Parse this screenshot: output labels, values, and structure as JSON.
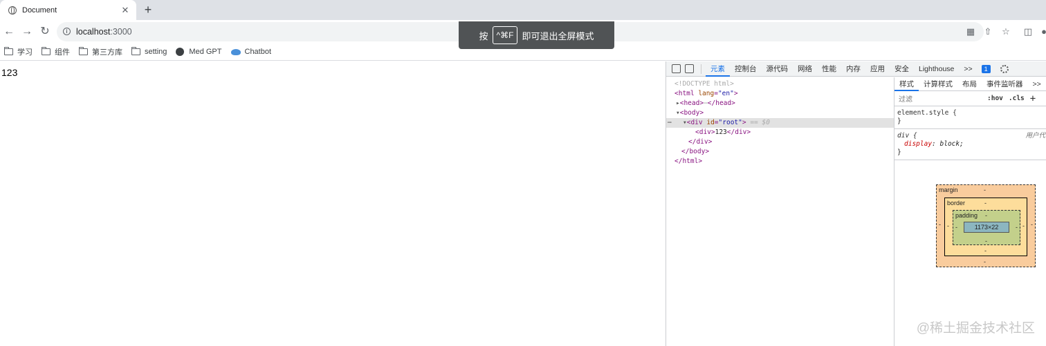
{
  "browser": {
    "tab_title": "Document",
    "close_glyph": "✕",
    "new_tab_glyph": "+",
    "url_host": "localhost",
    "url_port": ":3000",
    "info_glyph": "i"
  },
  "bookmarks": [
    {
      "label": "学习",
      "icon": "folder-icon"
    },
    {
      "label": "组件",
      "icon": "folder-icon"
    },
    {
      "label": "第三方库",
      "icon": "folder-icon"
    },
    {
      "label": "setting",
      "icon": "folder-icon"
    },
    {
      "label": "Med GPT",
      "icon": "globe-icon"
    },
    {
      "label": "Chatbot",
      "icon": "whale-icon"
    }
  ],
  "toast": {
    "prefix": "按",
    "key": "^⌘F",
    "suffix": "即可退出全屏模式"
  },
  "page": {
    "content": "123"
  },
  "devtools": {
    "tabs": [
      "元素",
      "控制台",
      "源代码",
      "网络",
      "性能",
      "内存",
      "应用",
      "安全",
      "Lighthouse"
    ],
    "more": ">>",
    "badge": "1",
    "dom": {
      "doctype": "<!DOCTYPE html>",
      "html_open": "<html ",
      "html_attr": "lang",
      "html_val": "\"en\"",
      "head": "<head>",
      "head_close": "</head>",
      "body": "<body>",
      "div_open": "<div ",
      "div_attr": "id",
      "div_val": "\"root\"",
      "div_sel_marker": "== $0",
      "inner_div_open": "<div>",
      "inner_text": "123",
      "inner_div_close": "</div>",
      "div_close": "</div>",
      "body_close": "</body>",
      "html_close": "</html>"
    },
    "styles_tabs": [
      "样式",
      "计算样式",
      "布局",
      "事件监听器"
    ],
    "filter_placeholder": "过滤",
    "hov": ":hov",
    "cls": ".cls",
    "rules": {
      "element_style": "element.style {",
      "close": "}",
      "div_selector": "div {",
      "div_prop": "display",
      "div_value": "block;",
      "ua_label": "用户代"
    },
    "boxmodel": {
      "margin": "margin",
      "border": "border",
      "padding": "padding",
      "content": "1173×22",
      "dash": "-"
    }
  },
  "watermark": "@稀土掘金技术社区"
}
